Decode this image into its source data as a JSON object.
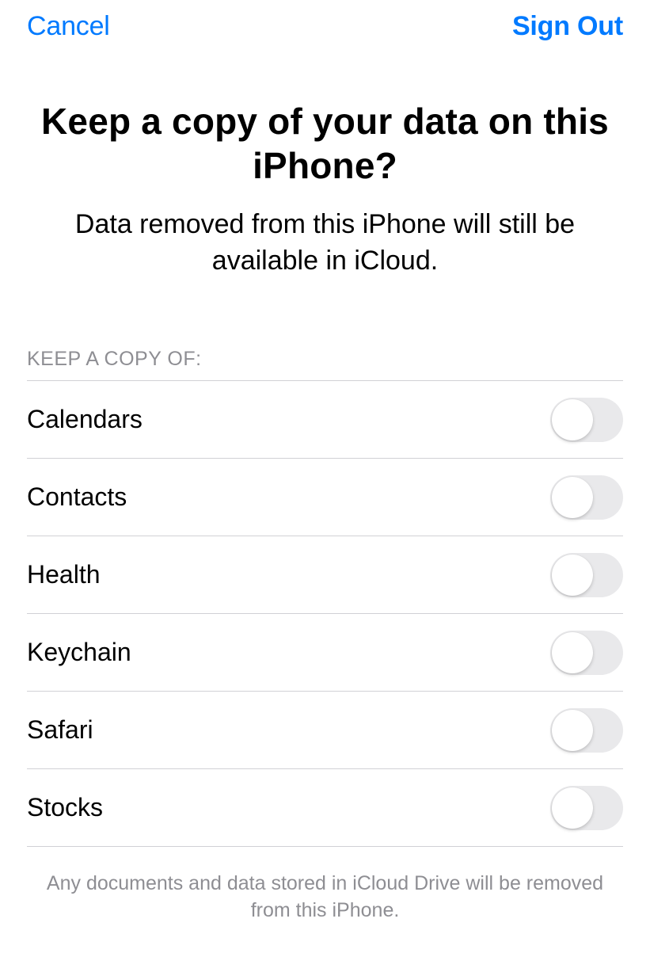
{
  "nav": {
    "cancel": "Cancel",
    "signOut": "Sign Out"
  },
  "header": {
    "title": "Keep a copy of your data on this iPhone?",
    "subtitle": "Data removed from this iPhone will still be available in iCloud."
  },
  "sectionHeader": "KEEP A COPY OF:",
  "items": [
    {
      "label": "Calendars",
      "on": false
    },
    {
      "label": "Contacts",
      "on": false
    },
    {
      "label": "Health",
      "on": false
    },
    {
      "label": "Keychain",
      "on": false
    },
    {
      "label": "Safari",
      "on": false
    },
    {
      "label": "Stocks",
      "on": false
    }
  ],
  "footerNote": "Any documents and data stored in iCloud Drive will be removed from this iPhone."
}
